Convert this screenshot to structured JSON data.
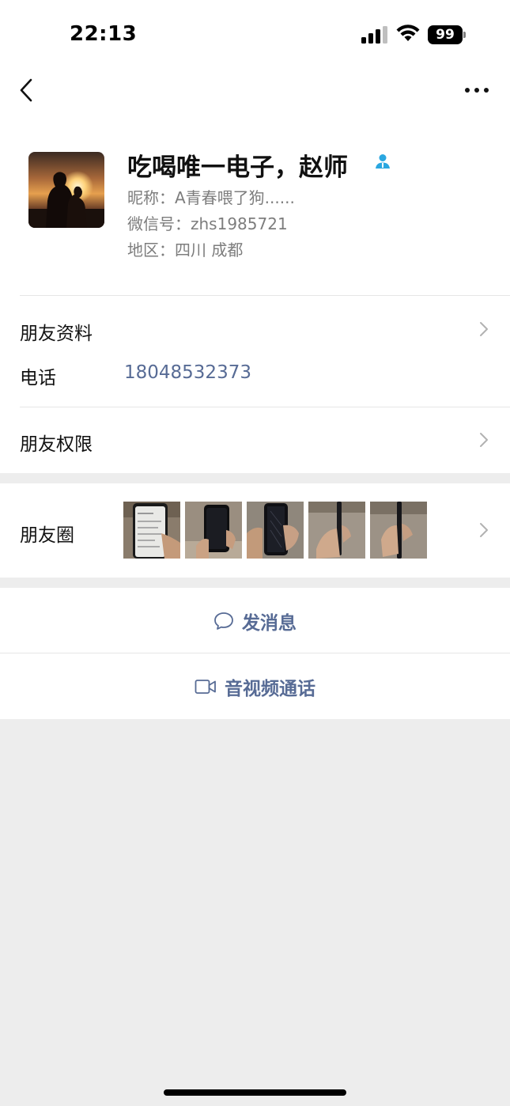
{
  "status_bar": {
    "time": "22:13",
    "battery": "99"
  },
  "nav": {
    "back_icon": "chevron-left-icon",
    "more_icon": "ellipsis-icon"
  },
  "profile": {
    "display_name": "吃喝唯一电子，赵师",
    "nickname": "昵称：A青春喂了狗......",
    "wechat_id": "微信号：zhs1985721",
    "region": "地区：四川 成都",
    "badge_icon": "contact-person-icon",
    "badge_color": "#2aa7e0"
  },
  "list": {
    "friend_info_label": "朋友资料",
    "phone_label": "电话",
    "phone_value": "18048532373",
    "permissions_label": "朋友权限",
    "moments_label": "朋友圈"
  },
  "actions": {
    "message_label": "发消息",
    "call_label": "音视频通话"
  },
  "colors": {
    "link": "#576b95",
    "secondary_text": "#7d7d7d",
    "background": "#ededed"
  }
}
